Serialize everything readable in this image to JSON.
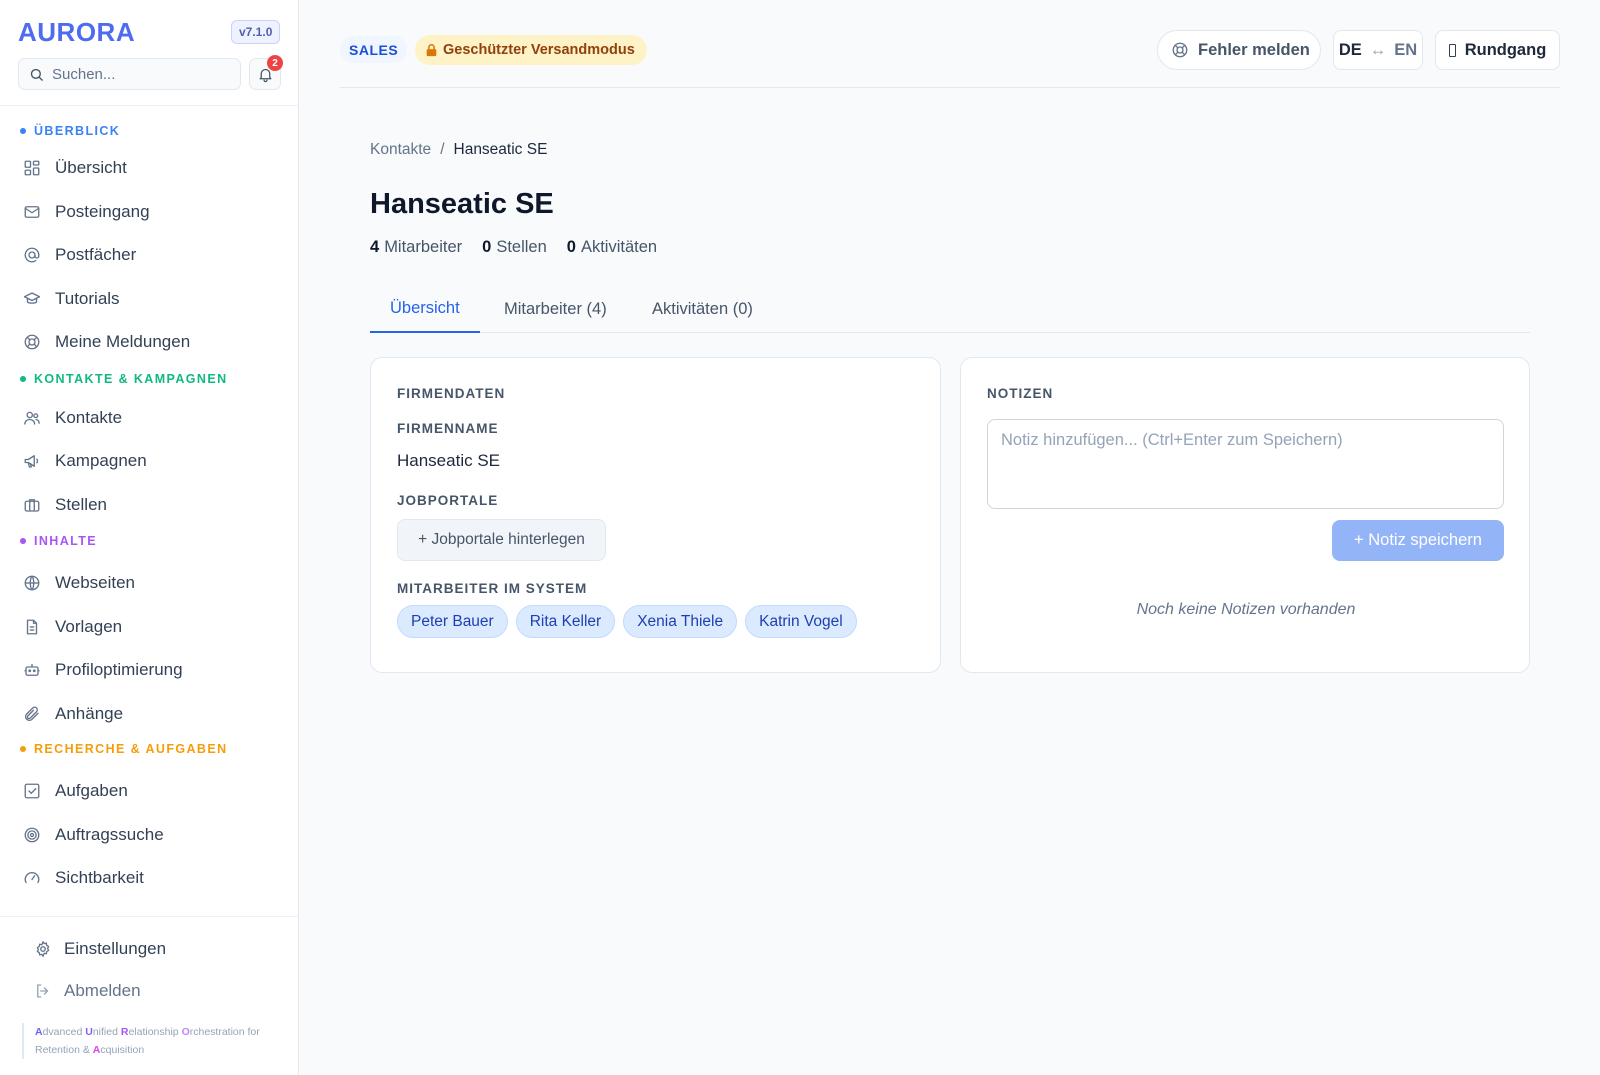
{
  "app": {
    "logo": "AURORA",
    "version": "v7.1.0",
    "search_placeholder": "Suchen...",
    "notification_count": "2"
  },
  "sidebar": {
    "sections": [
      {
        "label": "ÜBERBLICK",
        "color": "#3b82f6",
        "items": [
          {
            "label": "Übersicht",
            "icon": "grid-icon"
          },
          {
            "label": "Posteingang",
            "icon": "mail-icon"
          },
          {
            "label": "Postfächer",
            "icon": "at-icon"
          },
          {
            "label": "Tutorials",
            "icon": "graduation-cap-icon"
          },
          {
            "label": "Meine Meldungen",
            "icon": "lifebuoy-icon"
          }
        ]
      },
      {
        "label": "KONTAKTE & KAMPAGNEN",
        "color": "#10b981",
        "items": [
          {
            "label": "Kontakte",
            "icon": "users-icon"
          },
          {
            "label": "Kampagnen",
            "icon": "megaphone-icon"
          },
          {
            "label": "Stellen",
            "icon": "briefcase-icon"
          }
        ]
      },
      {
        "label": "INHALTE",
        "color": "#a855f7",
        "items": [
          {
            "label": "Webseiten",
            "icon": "globe-icon"
          },
          {
            "label": "Vorlagen",
            "icon": "document-icon"
          },
          {
            "label": "Profiloptimierung",
            "icon": "robot-icon"
          },
          {
            "label": "Anhänge",
            "icon": "paperclip-icon"
          }
        ]
      },
      {
        "label": "RECHERCHE & AUFGABEN",
        "color": "#f59e0b",
        "items": [
          {
            "label": "Aufgaben",
            "icon": "checkbox-icon"
          },
          {
            "label": "Auftragssuche",
            "icon": "target-icon"
          },
          {
            "label": "Sichtbarkeit",
            "icon": "gauge-icon"
          }
        ]
      }
    ],
    "footer": {
      "settings": "Einstellungen",
      "logout": "Abmelden",
      "tagline": [
        {
          "initial": "A",
          "rest": "dvanced "
        },
        {
          "initial": "U",
          "rest": "nified "
        },
        {
          "initial": "R",
          "rest": "elationship "
        },
        {
          "initial": "O",
          "rest": "rchestration for "
        },
        {
          "initial": "",
          "rest": "Retention & "
        },
        {
          "initial": "A",
          "rest": "cquisition"
        }
      ]
    }
  },
  "topbar": {
    "sales_badge": "SALES",
    "protected_badge": "Geschützter Versandmodus",
    "report_button": "Fehler melden",
    "lang_from": "DE",
    "lang_arrow": "↔",
    "lang_to": "EN",
    "tour_button": "Rundgang"
  },
  "page": {
    "breadcrumb": {
      "parent": "Kontakte",
      "separator": "/",
      "current": "Hanseatic SE"
    },
    "title": "Hanseatic SE",
    "stats": [
      {
        "value": "4",
        "label": "Mitarbeiter"
      },
      {
        "value": "0",
        "label": "Stellen"
      },
      {
        "value": "0",
        "label": "Aktivitäten"
      }
    ],
    "tabs": [
      "Übersicht",
      "Mitarbeiter (4)",
      "Aktivitäten (0)"
    ],
    "company_card": {
      "heading": "FIRMENDATEN",
      "name_label": "FIRMENNAME",
      "name_value": "Hanseatic SE",
      "portals_label": "JOBPORTALE",
      "portals_button": "+ Jobportale hinterlegen",
      "employees_label": "MITARBEITER IM SYSTEM",
      "employees": [
        "Peter Bauer",
        "Rita Keller",
        "Xenia Thiele",
        "Katrin Vogel"
      ]
    },
    "notes_card": {
      "heading": "NOTIZEN",
      "placeholder": "Notiz hinzufügen... (Ctrl+Enter zum Speichern)",
      "save_button": "+ Notiz speichern",
      "empty": "Noch keine Notizen vorhanden"
    }
  },
  "colors": {
    "accent": "#2563eb",
    "logo": "#4f6cf0",
    "chip_bg": "#dbeafe",
    "save_button": "#93b4f7",
    "warning_bg": "#fef3c7"
  }
}
